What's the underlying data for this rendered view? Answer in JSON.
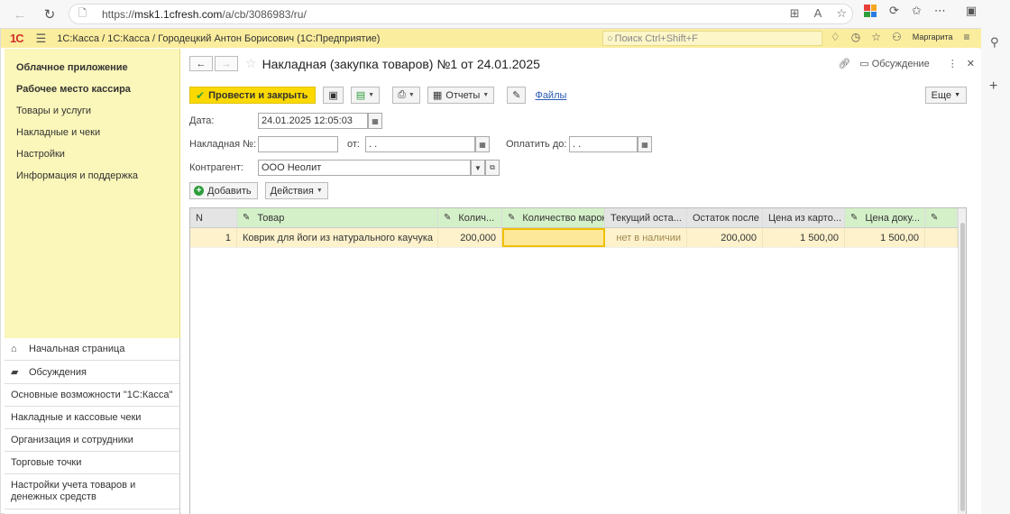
{
  "browser": {
    "url_scheme": "https://",
    "url_host": "msk1.1cfresh.com",
    "url_path": "/a/cb/3086983/ru/"
  },
  "header": {
    "logo": "1С",
    "title": "1С:Касса / 1С:Касса / Городецкий Антон Борисович  (1С:Предприятие)",
    "search_placeholder": "Поиск Ctrl+Shift+F",
    "user": "Маргарита"
  },
  "sidebar": {
    "top_items": [
      {
        "label": "Облачное приложение",
        "bold": true
      },
      {
        "label": "Рабочее место кассира",
        "bold": true
      },
      {
        "label": "Товары и услуги"
      },
      {
        "label": "Накладные и чеки"
      },
      {
        "label": "Настройки"
      },
      {
        "label": "Информация и поддержка"
      }
    ],
    "bottom_items": [
      {
        "label": "Начальная страница",
        "icon": "home-icon"
      },
      {
        "label": "Обсуждения",
        "icon": "chat-icon"
      },
      {
        "label": "Основные возможности \"1С:Касса\""
      },
      {
        "label": "Накладные и кассовые чеки"
      },
      {
        "label": "Организация и сотрудники"
      },
      {
        "label": "Торговые точки"
      },
      {
        "label": "Настройки учета товаров и денежных средств"
      }
    ]
  },
  "form": {
    "title": "Накладная (закупка товаров) №1 от 24.01.2025",
    "discussion": "Обсуждение",
    "post_and_close": "Провести и закрыть",
    "reports": "Отчеты",
    "files": "Файлы",
    "more": "Еще",
    "date_label": "Дата:",
    "date_value": "24.01.2025 12:05:03",
    "invoice_no_label": "Накладная №:",
    "invoice_no_value": "",
    "from_label": "от:",
    "from_value": " .  .",
    "pay_by_label": "Оплатить до:",
    "pay_by_value": " .  .",
    "counterparty_label": "Контрагент:",
    "counterparty_value": "ООО Неолит",
    "add": "Добавить",
    "actions": "Действия"
  },
  "table": {
    "columns": [
      "N",
      "Товар",
      "Колич...",
      "Количество марок",
      "Текущий оста...",
      "Остаток после",
      "Цена из карто...",
      "Цена доку..."
    ],
    "rows": [
      {
        "n": "1",
        "item": "Коврик для йоги из натурального каучука",
        "qty": "200,000",
        "marks": "",
        "current": "нет в наличии",
        "after": "200,000",
        "price_card": "1 500,00",
        "price_doc": "1 500,00"
      }
    ]
  },
  "colors": {
    "header_bg": "#fbed9e",
    "sidebar_bg": "#fbf6b9",
    "primary_button": "#fbd900",
    "row_highlight": "#fdf2cc"
  }
}
